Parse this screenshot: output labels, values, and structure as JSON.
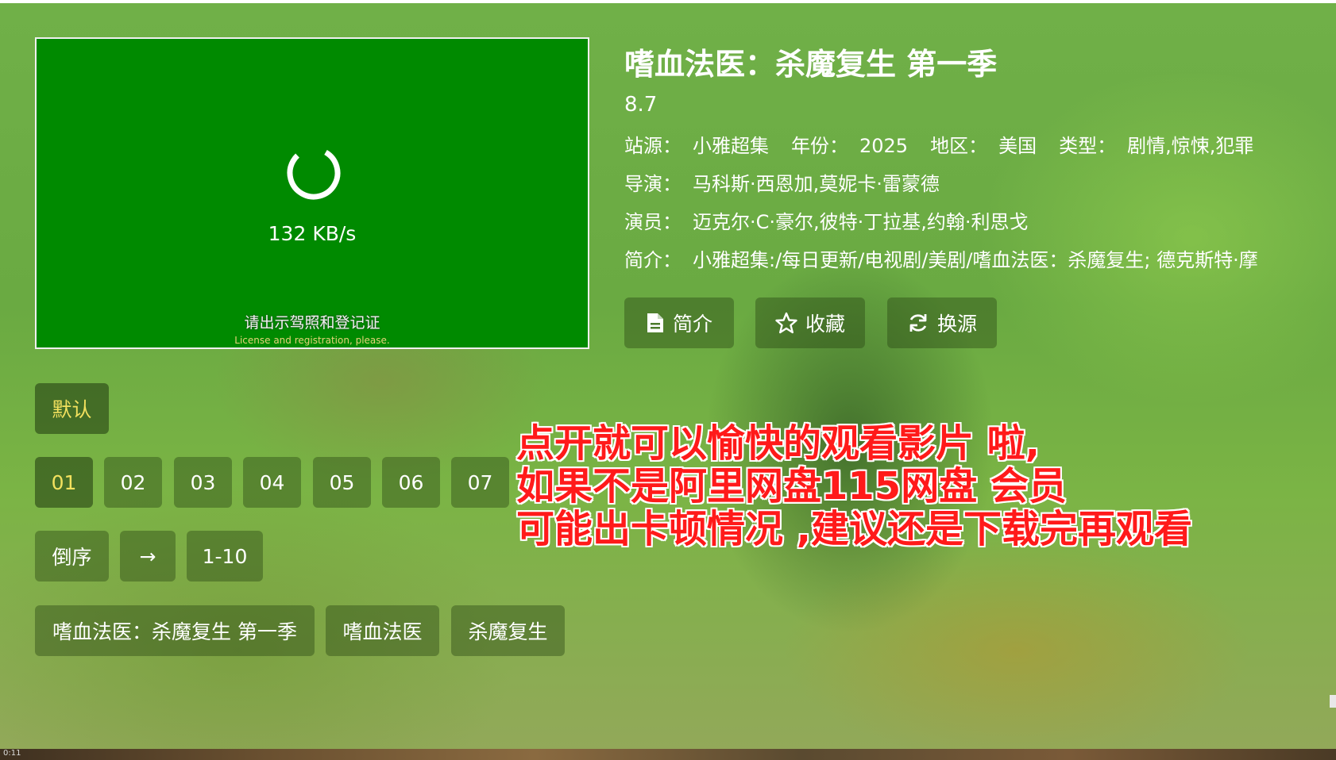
{
  "player": {
    "speed": "132 KB/s",
    "subtitle_cn": "请出示驾照和登记证",
    "subtitle_en": "License and registration, please."
  },
  "detail": {
    "title": "嗜血法医：杀魔复生 第一季",
    "rating": "8.7",
    "site_label": "站源：",
    "site": "小雅超集",
    "year_label": "年份：",
    "year": "2025",
    "region_label": "地区：",
    "region": "美国",
    "genre_label": "类型：",
    "genre": "剧情,惊悚,犯罪",
    "director_label": "导演：",
    "director": "马科斯·西恩加,莫妮卡·雷蒙德",
    "cast_label": "演员：",
    "cast": "迈克尔·C·豪尔,彼特·丁拉基,约翰·利思戈",
    "intro_label": "简介：",
    "intro": "小雅超集:/每日更新/电视剧/美剧/嗜血法医：杀魔复生; 德克斯特·摩"
  },
  "actions": {
    "intro": "简介",
    "favorite": "收藏",
    "switch_source": "换源"
  },
  "source_tab": "默认",
  "episodes": [
    "01",
    "02",
    "03",
    "04",
    "05",
    "06",
    "07"
  ],
  "controls": {
    "reverse": "倒序",
    "arrow": "→",
    "range": "1-10"
  },
  "related": [
    "嗜血法医：杀魔复生 第一季",
    "嗜血法医",
    "杀魔复生"
  ],
  "overlay_lines": [
    "点开就可以愉快的观看影片 啦,",
    "如果不是阿里网盘115网盘 会员",
    "可能出卡顿情况 ,建议还是下载完再观看"
  ],
  "colors": {
    "player_bg": "#008a00",
    "selected_text": "#f3e15e",
    "overlay_text": "#ff1a1a"
  },
  "bottom_corner_text": "0:11"
}
